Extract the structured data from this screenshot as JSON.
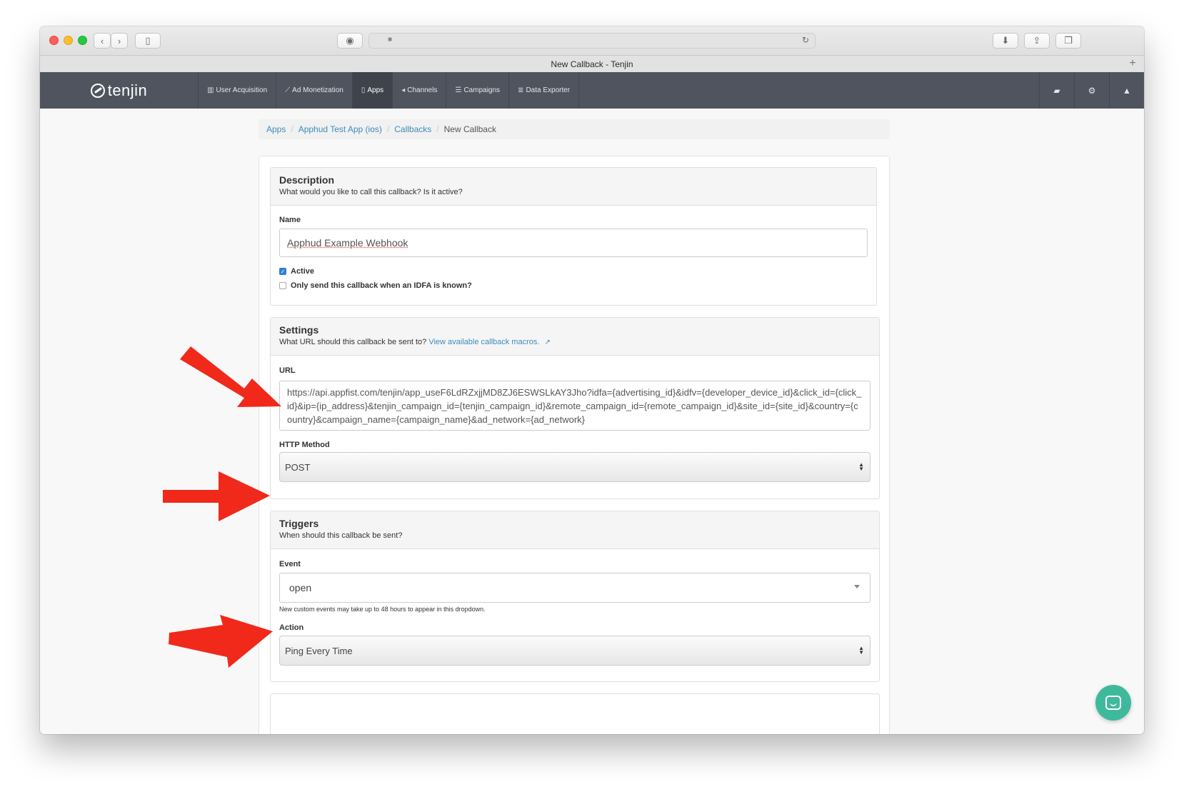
{
  "browser": {
    "tab_title": "New Callback - Tenjin",
    "tab_plus": "+"
  },
  "nav": {
    "brand": "tenjin",
    "items": [
      {
        "label": "User Acquisition",
        "icon": "bar-chart-icon"
      },
      {
        "label": "Ad Monetization",
        "icon": "line-chart-icon"
      },
      {
        "label": "Apps",
        "icon": "mobile-icon",
        "active": true
      },
      {
        "label": "Channels",
        "icon": "bullhorn-icon"
      },
      {
        "label": "Campaigns",
        "icon": "list-icon"
      },
      {
        "label": "Data Exporter",
        "icon": "database-icon"
      }
    ],
    "right_icons": [
      "book-icon",
      "settings-icon",
      "bell-icon"
    ]
  },
  "breadcrumb": {
    "items": [
      "Apps",
      "Apphud Test App (ios)",
      "Callbacks"
    ],
    "current": "New Callback"
  },
  "description": {
    "title": "Description",
    "subtitle": "What would you like to call this callback? Is it active?",
    "name_label": "Name",
    "name_value": "Apphud Example Webhook",
    "active_label": "Active",
    "active_checked": true,
    "idfa_label": "Only send this callback when an IDFA is known?",
    "idfa_checked": false
  },
  "settings": {
    "title": "Settings",
    "subtitle": "What URL should this callback be sent to?",
    "macros_link": "View available callback macros.",
    "url_label": "URL",
    "url_value": "https://api.appfist.com/tenjin/app_useF6LdRZxjjMD8ZJ6ESWSLkAY3Jho?idfa={advertising_id}&idfv={developer_device_id}&click_id={click_id}&ip={ip_address}&tenjin_campaign_id={tenjin_campaign_id}&remote_campaign_id={remote_campaign_id}&site_id={site_id}&country={country}&campaign_name={campaign_name}&ad_network={ad_network}",
    "method_label": "HTTP Method",
    "method_value": "POST"
  },
  "triggers": {
    "title": "Triggers",
    "subtitle": "When should this callback be sent?",
    "event_label": "Event",
    "event_value": "open",
    "event_help": "New custom events may take up to 48 hours to appear in this dropdown.",
    "action_label": "Action",
    "action_value": "Ping Every Time"
  },
  "colors": {
    "nav_bg": "#4f545f",
    "link": "#3d8bbd",
    "arrow": "#f0291a",
    "chat": "#3fb99c"
  }
}
